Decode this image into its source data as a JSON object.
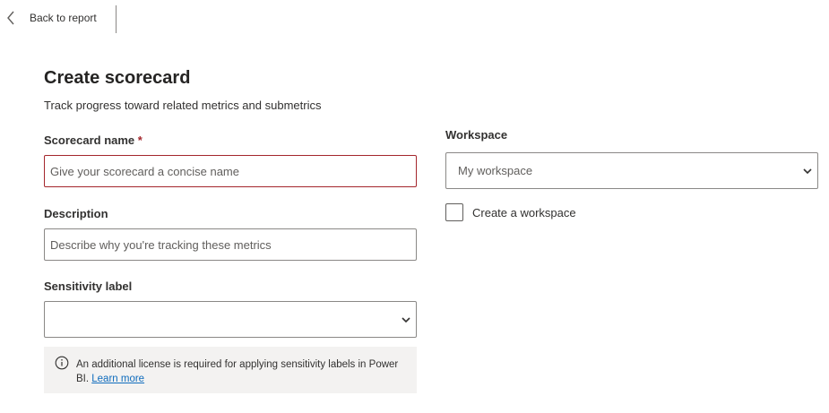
{
  "topbar": {
    "back_label": "Back to report"
  },
  "form": {
    "title": "Create scorecard",
    "subtitle": "Track progress toward related metrics and submetrics",
    "name": {
      "label": "Scorecard name",
      "required_mark": "*",
      "value": "",
      "placeholder": "Give your scorecard a concise name"
    },
    "description": {
      "label": "Description",
      "value": "",
      "placeholder": "Describe why you're tracking these metrics"
    },
    "sensitivity": {
      "label": "Sensitivity label",
      "selected": ""
    },
    "info": {
      "text": "An additional license is required for applying sensitivity labels in Power BI.",
      "link_label": "Learn more"
    },
    "workspace": {
      "label": "Workspace",
      "selected": "My workspace",
      "create_label": "Create a workspace",
      "create_checked": false
    }
  },
  "colors": {
    "error_border": "#a4262c",
    "link": "#0f6cbd",
    "info_background": "#f3f2f1"
  },
  "icons": {
    "back": "chevron-left-icon",
    "dropdown": "chevron-down-icon",
    "info": "info-circle-icon"
  }
}
